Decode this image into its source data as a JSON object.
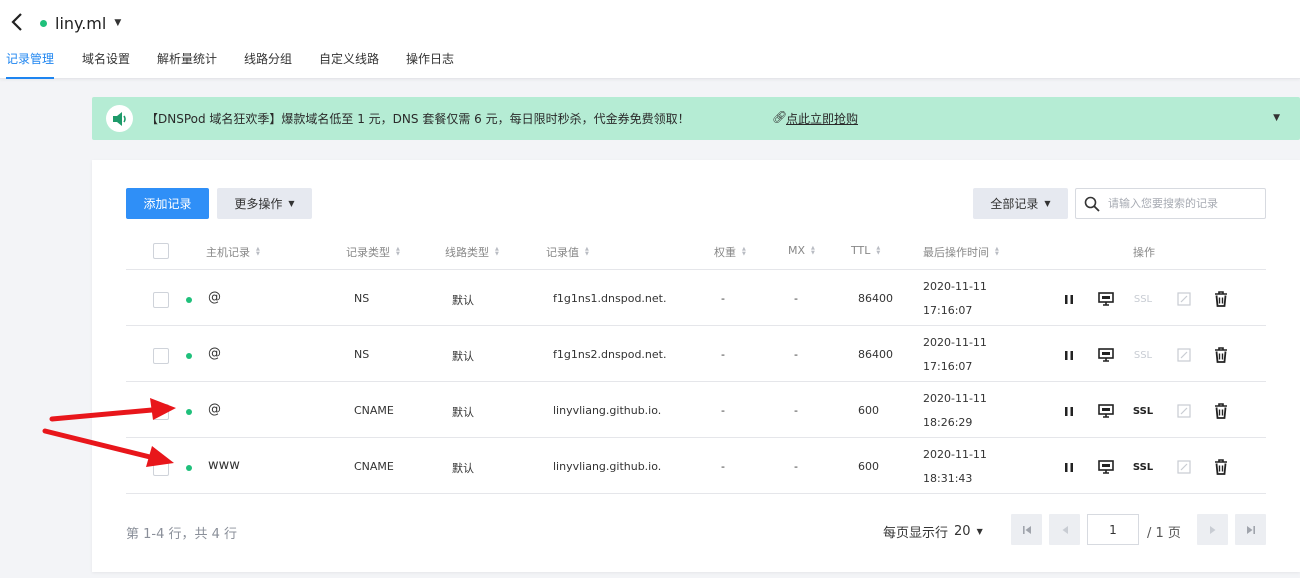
{
  "header": {
    "domain": "liny.ml",
    "tabs": [
      "记录管理",
      "域名设置",
      "解析量统计",
      "线路分组",
      "自定义线路",
      "操作日志"
    ]
  },
  "notice": {
    "text": "【DNSPod 域名狂欢季】爆款域名低至 1 元，DNS 套餐仅需 6 元，每日限时秒杀，代金券免费领取！",
    "link": "点此立即抢购"
  },
  "toolbar": {
    "add_label": "添加记录",
    "more_label": "更多操作",
    "filter_label": "全部记录",
    "search_placeholder": "请输入您要搜索的记录"
  },
  "table": {
    "columns": [
      "主机记录",
      "记录类型",
      "线路类型",
      "记录值",
      "权重",
      "MX",
      "TTL",
      "最后操作时间",
      "操作"
    ],
    "rows": [
      {
        "host": "@",
        "type": "NS",
        "line": "默认",
        "value": "f1g1ns1.dnspod.net.",
        "weight": "-",
        "mx": "-",
        "ttl": "86400",
        "date": "2020-11-11",
        "time": "17:16:07",
        "ssl": "SSL"
      },
      {
        "host": "@",
        "type": "NS",
        "line": "默认",
        "value": "f1g1ns2.dnspod.net.",
        "weight": "-",
        "mx": "-",
        "ttl": "86400",
        "date": "2020-11-11",
        "time": "17:16:07",
        "ssl": "SSL"
      },
      {
        "host": "@",
        "type": "CNAME",
        "line": "默认",
        "value": "linyvliang.github.io.",
        "weight": "-",
        "mx": "-",
        "ttl": "600",
        "date": "2020-11-11",
        "time": "18:26:29",
        "ssl": "SSL"
      },
      {
        "host": "www",
        "type": "CNAME",
        "line": "默认",
        "value": "linyvliang.github.io.",
        "weight": "-",
        "mx": "-",
        "ttl": "600",
        "date": "2020-11-11",
        "time": "18:31:43",
        "ssl": "SSL"
      }
    ]
  },
  "footer": {
    "summary": "第 1-4 行，共 4 行",
    "per_page_label": "每页显示行",
    "per_page_value": "20",
    "page": "1",
    "total_pages": "/ 1 页"
  },
  "colors": {
    "primary": "#2f8ff7",
    "tab_active": "#1e85f0",
    "notice_bg": "#b5ecd4",
    "status_dot": "#1fc07b",
    "annotation_arrow": "#e8161b"
  }
}
